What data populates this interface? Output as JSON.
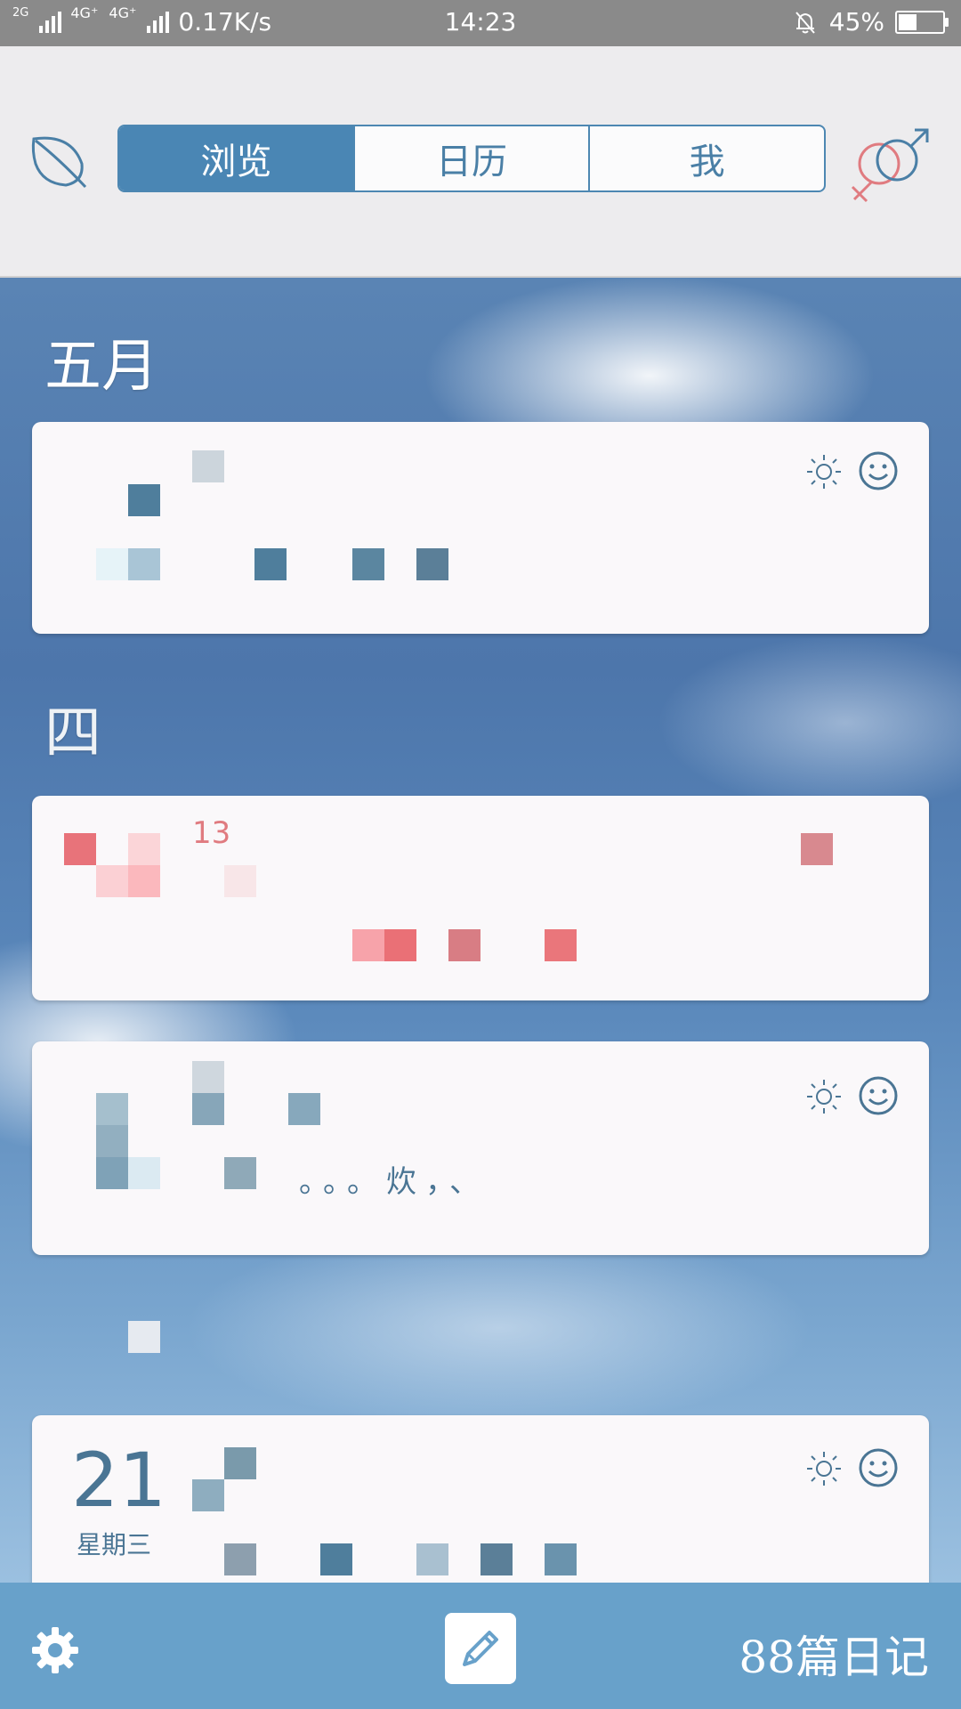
{
  "status_bar": {
    "network_1": "2G",
    "network_2": "4G⁺",
    "network_3": "4G⁺",
    "speed": "0.17K/s",
    "time": "14:23",
    "battery": "45%",
    "battery_level": 0.45
  },
  "header": {
    "left_icon": "leaf-icon",
    "right_icon": "gender-symbol-icon",
    "tabs": [
      {
        "label": "浏览",
        "active": true
      },
      {
        "label": "日历",
        "active": false
      },
      {
        "label": "我",
        "active": false
      }
    ]
  },
  "sections": [
    {
      "month": "五月"
    },
    {
      "month": "四"
    }
  ],
  "entries": [
    {
      "weather_icon": "sun-icon",
      "mood_icon": "smiley-icon"
    },
    {
      "day_number": "13",
      "accent_color": "#e07b80"
    },
    {
      "snippet": "。。。炊，、",
      "weather_icon": "sun-icon",
      "mood_icon": "smiley-icon"
    },
    {
      "day_number": "21",
      "weekday": "星期三",
      "weather_icon": "sun-icon",
      "mood_icon": "smiley-icon"
    }
  ],
  "bottom_bar": {
    "settings_icon": "gear-icon",
    "edit_icon": "pencil-icon",
    "diary_count": "88篇日记"
  },
  "colors": {
    "accent": "#4a86b4",
    "bottom_bar": "#68a1ca",
    "header_bg": "#edecee"
  }
}
